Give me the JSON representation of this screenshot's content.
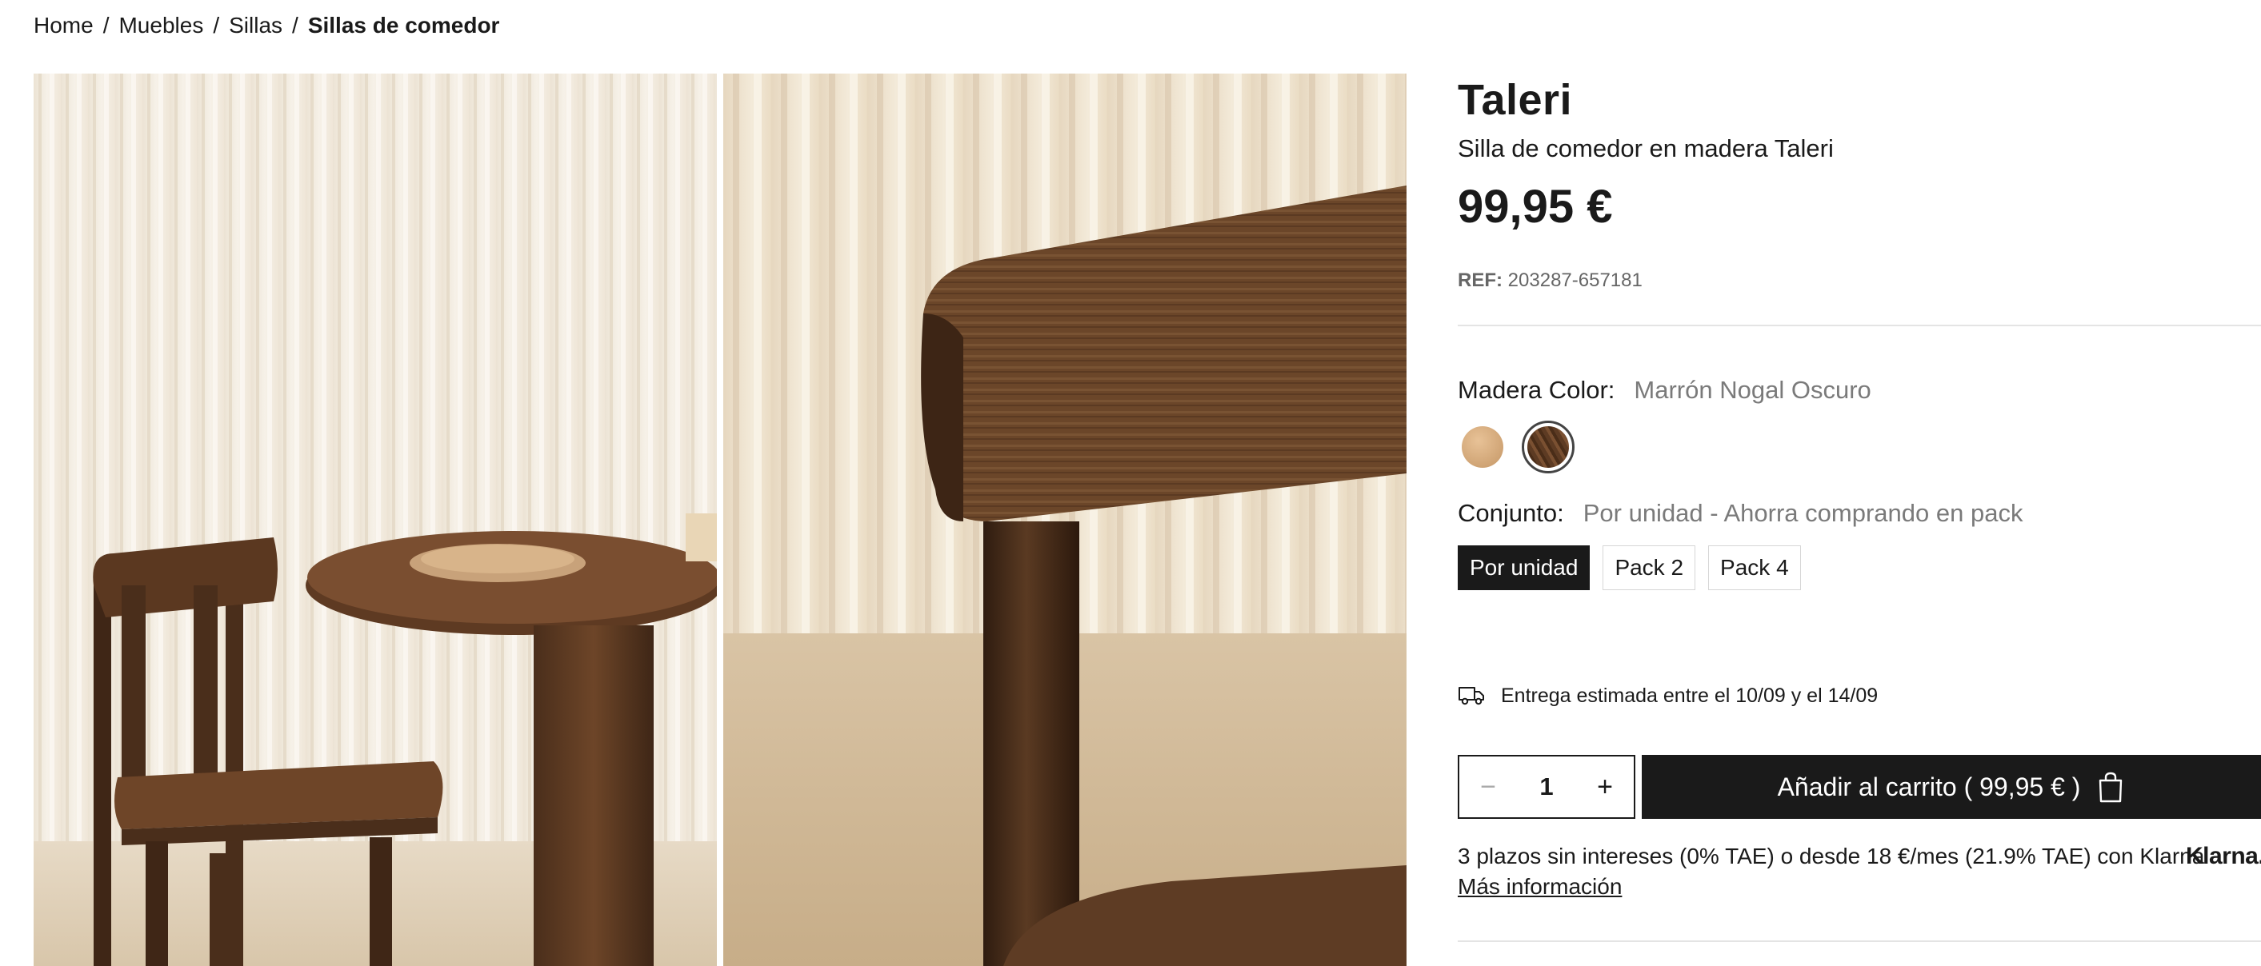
{
  "breadcrumb": {
    "items": [
      "Home",
      "Muebles",
      "Sillas"
    ],
    "separator": "/",
    "current": "Sillas de comedor"
  },
  "product": {
    "name": "Taleri",
    "subtitle": "Silla de comedor en madera Taleri",
    "price": "99,95 €",
    "ref_label": "REF:",
    "ref_value": "203287-657181"
  },
  "options": {
    "color": {
      "label": "Madera Color:",
      "selected": "Marrón Nogal Oscuro",
      "swatches": [
        {
          "name": "light-wood",
          "color": "#d4a574",
          "selected": false
        },
        {
          "name": "dark-walnut",
          "color": "#5d3b23",
          "selected": true
        }
      ]
    },
    "set": {
      "label": "Conjunto:",
      "selected": "Por unidad - Ahorra comprando en pack",
      "buttons": [
        "Por unidad",
        "Pack 2",
        "Pack 4"
      ],
      "active_index": 0
    }
  },
  "delivery": {
    "icon": "truck-icon",
    "text": "Entrega estimada entre el 10/09 y el 14/09"
  },
  "cart": {
    "quantity": "1",
    "minus": "−",
    "plus": "+",
    "add_label": "Añadir al carrito ( 99,95 € )",
    "icon": "shopping-bag-icon"
  },
  "financing": {
    "text": "3 plazos sin intereses (0% TAE) o desde 18 €/mes (21.9% TAE) con Klarna",
    "logo": "Klarna.",
    "more_link": "Más información"
  },
  "colors": {
    "text": "#1a1a1a",
    "muted": "#7a7a7a",
    "button_bg": "#1a1a1a",
    "divider": "#e4e4e4"
  }
}
